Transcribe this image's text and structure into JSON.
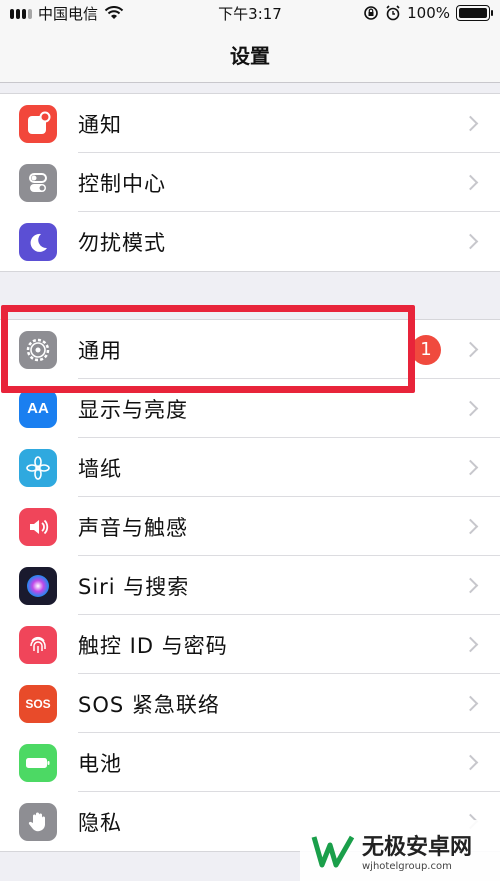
{
  "status": {
    "carrier": "中国电信",
    "time": "下午3:17",
    "battery": "100%"
  },
  "nav": {
    "title": "设置"
  },
  "group1": [
    {
      "label": "通知",
      "icon": "notifications-icon",
      "color": "#f2473b"
    },
    {
      "label": "控制中心",
      "icon": "control-center-icon",
      "color": "#8e8e93"
    },
    {
      "label": "勿扰模式",
      "icon": "moon-icon",
      "color": "#5b4fd4"
    }
  ],
  "group2": [
    {
      "label": "通用",
      "icon": "gear-icon",
      "color": "#8e8e93",
      "badge": "1"
    },
    {
      "label": "显示与亮度",
      "icon": "display-brightness-icon",
      "color": "#1a7ff0"
    },
    {
      "label": "墙纸",
      "icon": "wallpaper-icon",
      "color": "#2fa9df"
    },
    {
      "label": "声音与触感",
      "icon": "sound-icon",
      "color": "#f0455a"
    },
    {
      "label": "Siri 与搜索",
      "icon": "siri-icon",
      "color": "#1a1a2e"
    },
    {
      "label": "触控 ID 与密码",
      "icon": "fingerprint-icon",
      "color": "#f0455a"
    },
    {
      "label": "SOS 紧急联络",
      "icon": "sos-icon",
      "color": "#e84b2a",
      "icon_text": "SOS"
    },
    {
      "label": "电池",
      "icon": "battery-icon",
      "color": "#4cd964"
    },
    {
      "label": "隐私",
      "icon": "hand-icon",
      "color": "#8e8e93"
    }
  ],
  "watermark": {
    "title": "无极安卓网",
    "url": "wjhotelgroup.com"
  }
}
